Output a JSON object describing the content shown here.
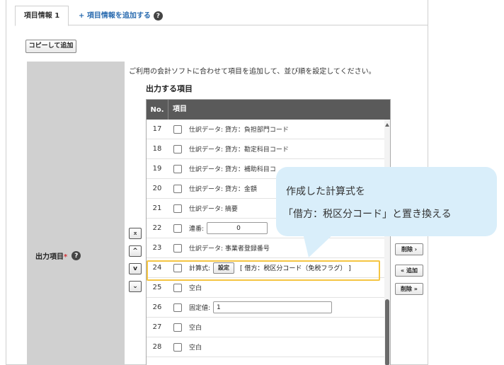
{
  "tabs": {
    "active_label": "項目情報 1",
    "add_label": "+ 項目情報を追加する"
  },
  "copy_button": "コピーして追加",
  "field_label": "出力項目",
  "required_mark": "*",
  "description": "ご利用の会計ソフトに合わせて項目を追加して、並び順を設定してください。",
  "section_title": "出力する項目",
  "table": {
    "col_no": "No.",
    "col_item": "項目",
    "rows": [
      {
        "no": "17",
        "text": "仕訳データ: 貸方：負担部門コード"
      },
      {
        "no": "18",
        "text": "仕訳データ: 貸方：勘定科目コード"
      },
      {
        "no": "19",
        "text": "仕訳データ: 貸方：補助科目コ"
      },
      {
        "no": "20",
        "text": "仕訳データ: 貸方：金額"
      },
      {
        "no": "21",
        "text": "仕訳データ: 摘要"
      },
      {
        "no": "22",
        "text": "連番:",
        "input_value": "0"
      },
      {
        "no": "23",
        "text": "仕訳データ: 事業者登録番号"
      },
      {
        "no": "24",
        "text": "計算式:",
        "button": "設定",
        "formula": "[ 借方：税区分コード（免税フラグ） ]"
      },
      {
        "no": "25",
        "text": "空白"
      },
      {
        "no": "26",
        "text": "固定値:",
        "input_value": "1"
      },
      {
        "no": "27",
        "text": "空白"
      },
      {
        "no": "28",
        "text": "空白"
      }
    ]
  },
  "order_buttons": {
    "top": "⌅",
    "up": "^",
    "down": "v",
    "bottom": "⌄"
  },
  "action_buttons": {
    "remove": "削除 ›",
    "add_all": "« 追加",
    "remove_all": "削除 »"
  },
  "callout": {
    "line1": "作成した計算式を",
    "line2": "「借方：税区分コード」と置き換える"
  },
  "colors": {
    "highlight": "#f5c542",
    "callout_bg": "#d9eefa",
    "header_bg": "#5a5a5a",
    "link": "#2b6cb0",
    "required": "#d13438"
  }
}
